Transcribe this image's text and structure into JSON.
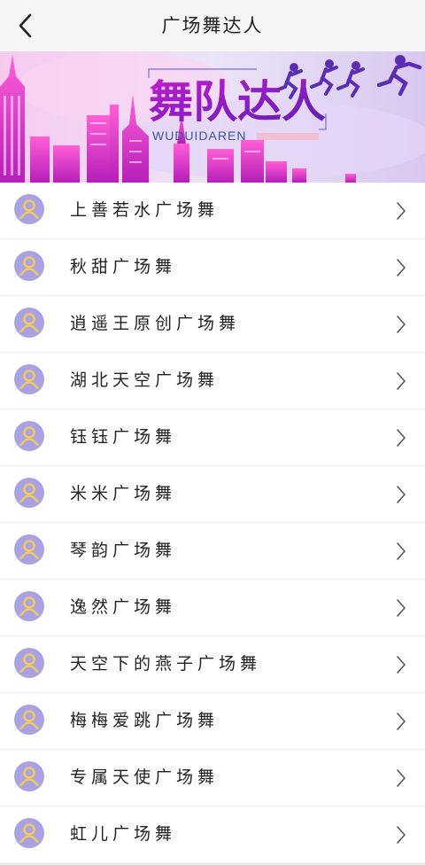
{
  "header": {
    "title": "广场舞达人",
    "back_icon": "chevron-left-icon"
  },
  "banner": {
    "main_text": "舞队达人",
    "sub_text": "WUDUIDAREN"
  },
  "list": {
    "avatar_icon": "user-avatar-icon",
    "chevron_icon": "chevron-right-icon",
    "avatar_color": "#a9a3e3",
    "avatar_figure_color": "#f2c863",
    "items": [
      {
        "name": "上善若水广场舞"
      },
      {
        "name": "秋甜广场舞"
      },
      {
        "name": "逍遥王原创广场舞"
      },
      {
        "name": "湖北天空广场舞"
      },
      {
        "name": "钰钰广场舞"
      },
      {
        "name": "米米广场舞"
      },
      {
        "name": "琴韵广场舞"
      },
      {
        "name": "逸然广场舞"
      },
      {
        "name": "天空下的燕子广场舞"
      },
      {
        "name": "梅梅爱跳广场舞"
      },
      {
        "name": "专属天使广场舞"
      },
      {
        "name": "虹儿广场舞"
      }
    ]
  }
}
